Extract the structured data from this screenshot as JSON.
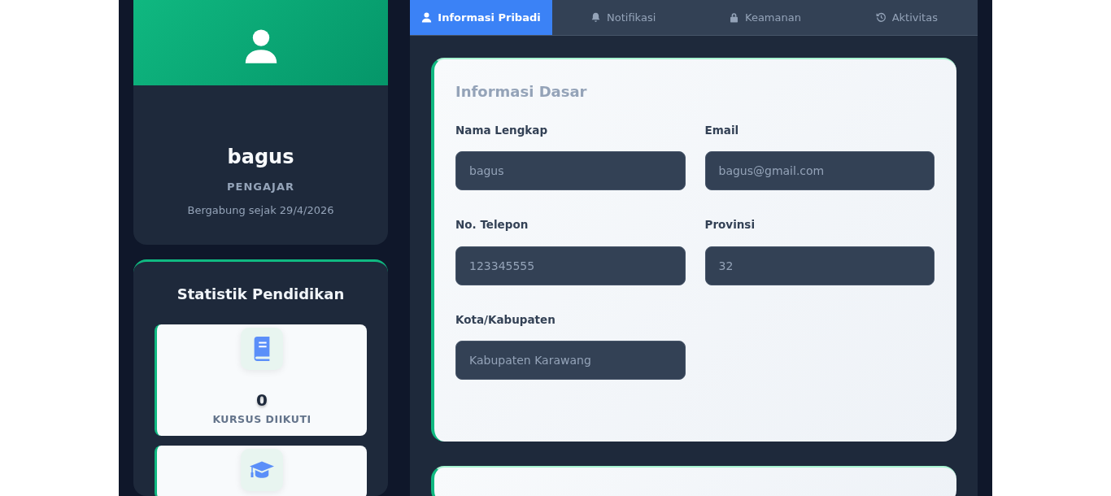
{
  "profile": {
    "name": "bagus",
    "role": "PENGAJAR",
    "joined": "Bergabung sejak 29/4/2026"
  },
  "stats": {
    "title": "Statistik Pendidikan",
    "items": [
      {
        "kind": "stat",
        "value": "0",
        "label": "KURSUS DIIKUTI"
      },
      {
        "kind": "stat"
      }
    ]
  },
  "tabs": [
    {
      "label": "Informasi Pribadi",
      "selected": true
    },
    {
      "label": "Notifikasi",
      "selected": false
    },
    {
      "label": "Keamanan",
      "selected": false
    },
    {
      "label": "Aktivitas",
      "selected": false
    }
  ],
  "basic_info": {
    "title": "Informasi Dasar",
    "fields": [
      {
        "label": "Nama Lengkap",
        "value": "bagus"
      },
      {
        "label": "Email",
        "value": "bagus@gmail.com"
      },
      {
        "label": "No. Telepon",
        "value": "123345555"
      },
      {
        "label": "Provinsi",
        "value": "32"
      },
      {
        "label": "Kota/Kabupaten",
        "value": "Kabupaten Karawang"
      }
    ]
  }
}
